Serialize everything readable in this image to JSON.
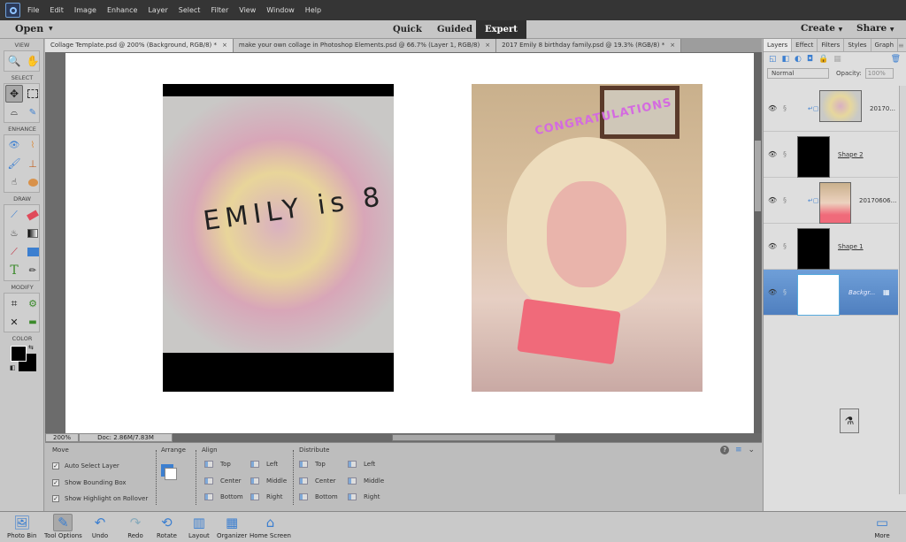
{
  "menubar": {
    "items": [
      "File",
      "Edit",
      "Image",
      "Enhance",
      "Layer",
      "Select",
      "Filter",
      "View",
      "Window",
      "Help"
    ]
  },
  "modebar": {
    "open_label": "Open",
    "modes": [
      "Quick",
      "Guided",
      "Expert"
    ],
    "active_mode": "Expert",
    "create_label": "Create",
    "share_label": "Share"
  },
  "toolbox": {
    "sections": [
      "VIEW",
      "SELECT",
      "ENHANCE",
      "DRAW",
      "MODIFY",
      "COLOR"
    ],
    "colors": {
      "foreground": "#000000",
      "background": "#000000"
    }
  },
  "doc_tabs": [
    {
      "title": "Collage Template.psd @ 200% (Background, RGB/8) *",
      "close": "×"
    },
    {
      "title": "make your own collage in Photoshop Elements.psd @ 66.7% (Layer 1, RGB/8)",
      "close": "×"
    },
    {
      "title": "2017 Emily 8 birthday family.psd @ 19.3% (RGB/8) *",
      "close": "×"
    }
  ],
  "canvas": {
    "photo_left_text": "EMILY is 8",
    "photo_right_text": "CONGRATULATIONS"
  },
  "statusbar": {
    "zoom": "200%",
    "doc_size": "Doc: 2.86M/7.83M"
  },
  "tool_options": {
    "move": {
      "title": "Move",
      "checks": [
        {
          "label": "Auto Select Layer",
          "checked": true
        },
        {
          "label": "Show Bounding Box",
          "checked": true
        },
        {
          "label": "Show Highlight on Rollover",
          "checked": true
        }
      ]
    },
    "arrange": {
      "title": "Arrange"
    },
    "align": {
      "title": "Align",
      "col1": [
        "Top",
        "Center",
        "Bottom"
      ],
      "col2": [
        "Left",
        "Middle",
        "Right"
      ]
    },
    "distribute": {
      "title": "Distribute",
      "col1": [
        "Top",
        "Center",
        "Bottom"
      ],
      "col2": [
        "Left",
        "Middle",
        "Right"
      ]
    },
    "help": "?",
    "menu": "≡",
    "collapse": "⌄"
  },
  "panel": {
    "tabs": [
      "Layers",
      "Effect",
      "Filters",
      "Styles",
      "Graph"
    ],
    "active_tab": "Layers",
    "blend_mode": "Normal",
    "opacity_label": "Opacity:",
    "opacity_value": "100%",
    "layers": [
      {
        "name": "20170...",
        "type": "photo-cupcakes",
        "visible": true,
        "selected": false
      },
      {
        "name": "Shape 2",
        "type": "shape",
        "visible": true,
        "selected": false
      },
      {
        "name": "20170606...",
        "type": "photo-girl",
        "visible": true,
        "selected": false
      },
      {
        "name": "Shape 1",
        "type": "shape",
        "visible": true,
        "selected": false
      },
      {
        "name": "Backgr...",
        "type": "background",
        "visible": true,
        "selected": true
      }
    ]
  },
  "bottombar": {
    "items": [
      "Photo Bin",
      "Tool Options",
      "Undo",
      "Redo",
      "Rotate",
      "Layout",
      "Organizer",
      "Home Screen"
    ],
    "more": "More"
  }
}
